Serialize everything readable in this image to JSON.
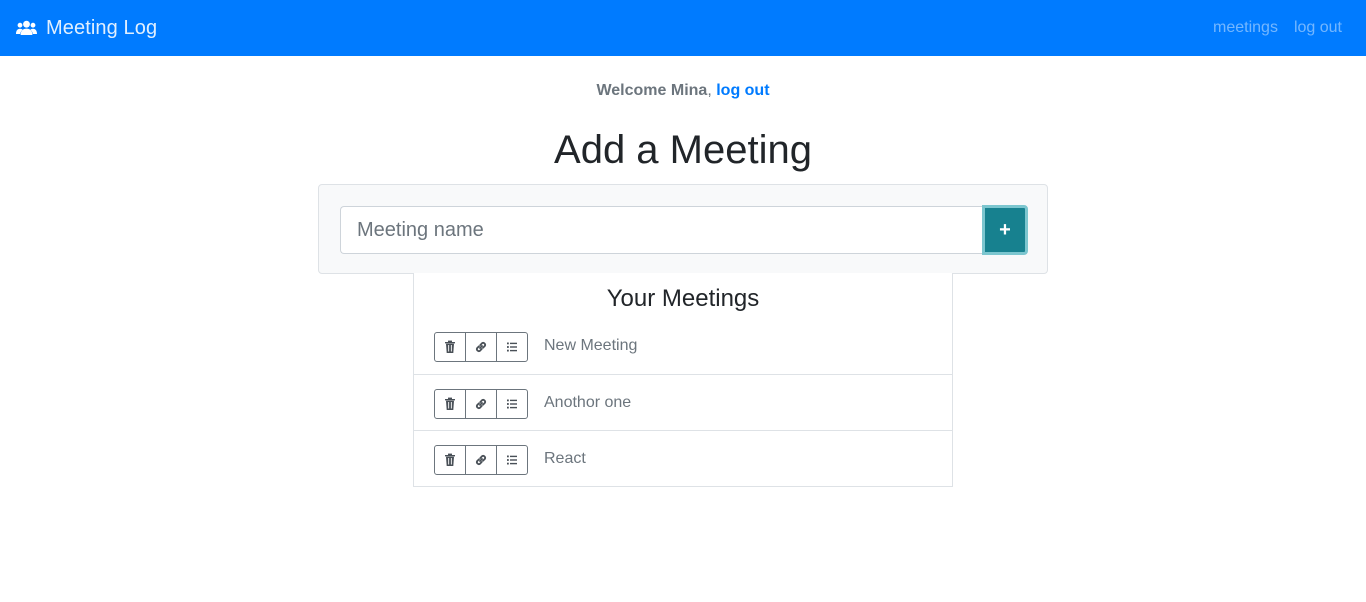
{
  "app": {
    "title": "Meeting Log",
    "brand_icon": "users-icon",
    "accent_color": "#007bff"
  },
  "nav": {
    "links": [
      {
        "label": "meetings"
      },
      {
        "label": "log out"
      }
    ]
  },
  "welcome": {
    "greeting": "Welcome Mina",
    "separator": ",",
    "logout_label": "log out"
  },
  "page": {
    "title": "Add a Meeting"
  },
  "add_form": {
    "placeholder": "Meeting name",
    "value": "",
    "submit_label": "+",
    "button_color": "#17818f"
  },
  "meetings": {
    "title": "Your Meetings",
    "row_actions": [
      "trash-icon",
      "link-icon",
      "list-icon"
    ],
    "items": [
      {
        "name": "New Meeting"
      },
      {
        "name": "Anothor one"
      },
      {
        "name": "React"
      }
    ]
  }
}
